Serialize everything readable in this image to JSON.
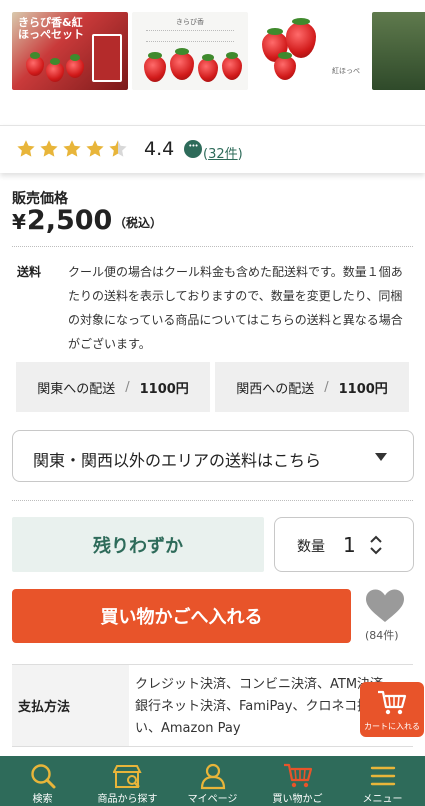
{
  "gallery": {
    "thumb1_caption": "きらぴ香&紅ほっぺセット",
    "thumb2_caption": "きらぴ香",
    "thumb3_caption": "紅ほっぺ"
  },
  "rating": {
    "score": "4.4",
    "stars": 4.5,
    "review_open": "(",
    "review_count": "32件",
    "review_close": ")"
  },
  "price": {
    "label": "販売価格",
    "yen_symbol": "¥",
    "amount": "2,500",
    "tax_note": "（税込）"
  },
  "shipping": {
    "label": "送料",
    "description": "クール便の場合はクール料金も含めた配送料です。数量１個あたりの送料を表示しておりますので、数量を変更したり、同梱の対象になっている商品についてはこちらの送料と異なる場合がございます。",
    "kanto_label": "関東への配送",
    "kanto_price": "1100円",
    "kansai_label": "関西への配送",
    "kansai_price": "1100円",
    "separator": "/",
    "other_area_select": "関東・関西以外のエリアの送料はこちら"
  },
  "purchase": {
    "stock_status": "残りわずか",
    "qty_label": "数量",
    "qty_value": "1",
    "add_to_cart": "買い物かごへ入れる",
    "favorite_count": "(84件)"
  },
  "payment": {
    "label": "支払方法",
    "methods": "クレジット決済、コンビニ決済、ATM決済、銀行ネット決済、FamiPay、クロネコ掛け払い、Amazon Pay"
  },
  "floating_cart": {
    "label": "カートに入れる"
  },
  "bottom_nav": {
    "items": [
      {
        "label": "検索",
        "icon": "search-icon"
      },
      {
        "label": "商品から探す",
        "icon": "shop-icon"
      },
      {
        "label": "マイページ",
        "icon": "user-icon"
      },
      {
        "label": "買い物かご",
        "icon": "cart-icon"
      },
      {
        "label": "メニュー",
        "icon": "menu-icon"
      }
    ]
  },
  "colors": {
    "brand_green": "#2e6b5a",
    "accent_orange": "#e8542a",
    "star": "#e8b53a"
  }
}
